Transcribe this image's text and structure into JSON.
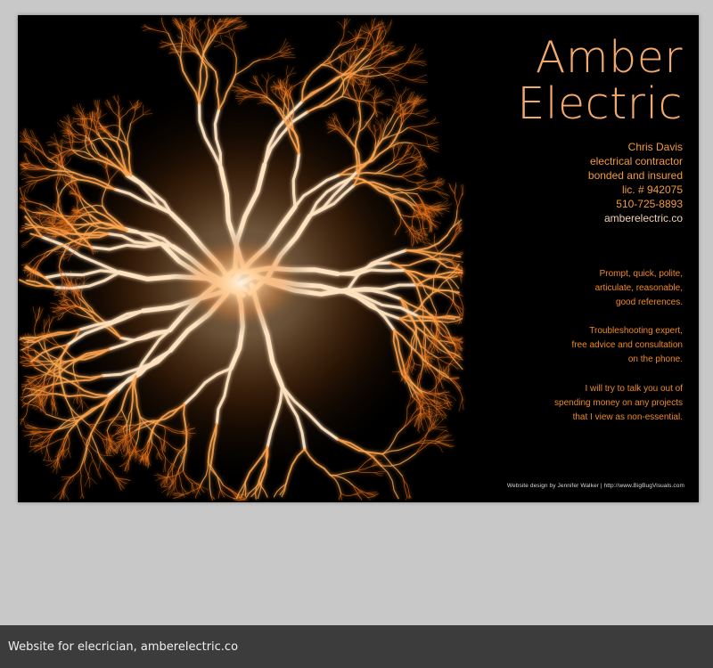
{
  "colors": {
    "page_bg": "#c8c8c8",
    "panel_bg": "#000000",
    "brand": "#f3a96a",
    "contact": "#f59a38",
    "site_link": "#f0d0b0",
    "body_text": "#f08a1e",
    "credit": "#d8d8d8",
    "footer_bg": "#3c3c3c",
    "footer_text": "#f0f0f0"
  },
  "hero": {
    "image_icon": "lightning-burst-icon"
  },
  "brand": {
    "line1": "Amber",
    "line2": "Electric"
  },
  "contact": {
    "name": "Chris Davis",
    "title": "electrical contractor",
    "bonded": "bonded and insured",
    "license": "lic. # 942075",
    "phone": "510-725-8893",
    "website": "amberelectric.co"
  },
  "paragraphs": [
    [
      "Prompt, quick, polite,",
      "articulate, reasonable,",
      "good references."
    ],
    [
      "Troubleshooting expert,",
      "free advice and consultation",
      "on the phone."
    ],
    [
      "I will try to talk you out of",
      "spending money on any projects",
      "that I view as non-essential."
    ]
  ],
  "credit": "Website design by Jennifer Walker | http://www.BigBugVisuals.com",
  "caption": "Website for elecrician, amberelectric.co"
}
